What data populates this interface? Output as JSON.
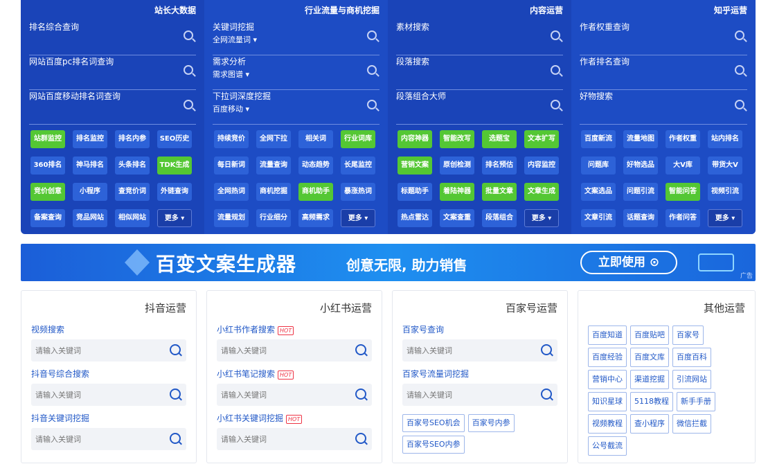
{
  "top": {
    "columns": [
      {
        "title": "站长大数据",
        "rows": [
          {
            "label": "排名综合查询",
            "sub": ""
          },
          {
            "label": "网站百度pc排名词查询",
            "sub": ""
          },
          {
            "label": "网站百度移动排名词查询",
            "sub": ""
          }
        ],
        "buttons": [
          {
            "label": "站群监控",
            "tone": "g"
          },
          {
            "label": "排名监控",
            "tone": "b"
          },
          {
            "label": "排名内参",
            "tone": "b"
          },
          {
            "label": "SEO历史",
            "tone": "b"
          },
          {
            "label": "360排名",
            "tone": "b"
          },
          {
            "label": "神马排名",
            "tone": "b"
          },
          {
            "label": "头条排名",
            "tone": "b"
          },
          {
            "label": "TDK生成",
            "tone": "g"
          },
          {
            "label": "竞价创意",
            "tone": "g"
          },
          {
            "label": "小程序",
            "tone": "b"
          },
          {
            "label": "查竞价词",
            "tone": "b"
          },
          {
            "label": "外链查询",
            "tone": "b"
          },
          {
            "label": "备案查询",
            "tone": "b"
          },
          {
            "label": "竞品网站",
            "tone": "b"
          },
          {
            "label": "相似网站",
            "tone": "b"
          },
          {
            "label": "更多 ▾",
            "tone": "m"
          }
        ]
      },
      {
        "title": "行业流量与商机挖掘",
        "rows": [
          {
            "label": "关键词挖掘",
            "sub": "全网流量词 ▾"
          },
          {
            "label": "需求分析",
            "sub": "需求图谱 ▾"
          },
          {
            "label": "下拉词深度挖掘",
            "sub": "百度移动 ▾"
          }
        ],
        "buttons": [
          {
            "label": "持续竞价",
            "tone": "b"
          },
          {
            "label": "全网下拉",
            "tone": "b"
          },
          {
            "label": "相关词",
            "tone": "b"
          },
          {
            "label": "行业词库",
            "tone": "g"
          },
          {
            "label": "每日新词",
            "tone": "b"
          },
          {
            "label": "流量查询",
            "tone": "b"
          },
          {
            "label": "动态趋势",
            "tone": "b"
          },
          {
            "label": "长尾监控",
            "tone": "b"
          },
          {
            "label": "全网热词",
            "tone": "b"
          },
          {
            "label": "商机挖掘",
            "tone": "b"
          },
          {
            "label": "商机助手",
            "tone": "g"
          },
          {
            "label": "暴涨热词",
            "tone": "b"
          },
          {
            "label": "流量规划",
            "tone": "b"
          },
          {
            "label": "行业细分",
            "tone": "b"
          },
          {
            "label": "高频需求",
            "tone": "b"
          },
          {
            "label": "更多 ▾",
            "tone": "m"
          }
        ]
      },
      {
        "title": "内容运营",
        "rows": [
          {
            "label": "素材搜索",
            "sub": ""
          },
          {
            "label": "段落搜索",
            "sub": ""
          },
          {
            "label": "段落组合大师",
            "sub": ""
          }
        ],
        "buttons": [
          {
            "label": "内容神器",
            "tone": "g"
          },
          {
            "label": "智能改写",
            "tone": "g"
          },
          {
            "label": "选题宝",
            "tone": "g"
          },
          {
            "label": "文本扩写",
            "tone": "g"
          },
          {
            "label": "营销文案",
            "tone": "g"
          },
          {
            "label": "原创检测",
            "tone": "b"
          },
          {
            "label": "排名预估",
            "tone": "b"
          },
          {
            "label": "内容监控",
            "tone": "b"
          },
          {
            "label": "标题助手",
            "tone": "b"
          },
          {
            "label": "着陆神器",
            "tone": "g"
          },
          {
            "label": "批量文章",
            "tone": "g"
          },
          {
            "label": "文章生成",
            "tone": "g"
          },
          {
            "label": "热点雷达",
            "tone": "b"
          },
          {
            "label": "文案查重",
            "tone": "b"
          },
          {
            "label": "段落组合",
            "tone": "b"
          },
          {
            "label": "更多 ▾",
            "tone": "m"
          }
        ]
      },
      {
        "title": "知乎运营",
        "rows": [
          {
            "label": "作者权重查询",
            "sub": ""
          },
          {
            "label": "作者排名查询",
            "sub": ""
          },
          {
            "label": "好物搜索",
            "sub": ""
          }
        ],
        "buttons": [
          {
            "label": "百度新流",
            "tone": "b"
          },
          {
            "label": "流量地图",
            "tone": "b"
          },
          {
            "label": "作者权重",
            "tone": "b"
          },
          {
            "label": "站内排名",
            "tone": "b"
          },
          {
            "label": "问题库",
            "tone": "b"
          },
          {
            "label": "好物选品",
            "tone": "b"
          },
          {
            "label": "大V库",
            "tone": "b"
          },
          {
            "label": "带货大V",
            "tone": "b"
          },
          {
            "label": "文案选品",
            "tone": "b"
          },
          {
            "label": "问题引流",
            "tone": "b"
          },
          {
            "label": "智能问答",
            "tone": "g"
          },
          {
            "label": "视频引流",
            "tone": "b"
          },
          {
            "label": "文章引流",
            "tone": "b"
          },
          {
            "label": "话题查询",
            "tone": "b"
          },
          {
            "label": "作者问答",
            "tone": "b"
          },
          {
            "label": "更多 ▾",
            "tone": "m"
          }
        ]
      }
    ]
  },
  "banner": {
    "title": "百变文案生成器",
    "slogan": "创意无限, 助力销售",
    "cta": "立即使用 ⊙",
    "ad": "广告"
  },
  "cards": {
    "douyin": {
      "title": "抖音运营",
      "fields": [
        {
          "label": "视频搜索",
          "placeholder": "请输入关键词"
        },
        {
          "label": "抖音号综合搜索",
          "placeholder": "请输入关键词"
        },
        {
          "label": "抖音关键词挖掘",
          "placeholder": "请输入关键词"
        }
      ]
    },
    "xhs": {
      "title": "小红书运营",
      "hot": "HOT",
      "fields": [
        {
          "label": "小红书作者搜索",
          "placeholder": "请输入关键词"
        },
        {
          "label": "小红书笔记搜索",
          "placeholder": "请输入关键词"
        },
        {
          "label": "小红书关键词挖掘",
          "placeholder": "请输入关键词"
        }
      ]
    },
    "baijia": {
      "title": "百家号运营",
      "fields": [
        {
          "label": "百家号查询",
          "placeholder": "请输入关键词"
        },
        {
          "label": "百家号流量词挖掘",
          "placeholder": "请输入关键词"
        }
      ],
      "chips": [
        "百家号SEO机会",
        "百家号内参",
        "百家号SEO内参"
      ]
    },
    "other": {
      "title": "其他运营",
      "chips": [
        "百度知道",
        "百度贴吧",
        "百家号",
        "百度经验",
        "百度文库",
        "百度百科",
        "营销中心",
        "渠道挖掘",
        "引流网站",
        "知识星球",
        "5118教程",
        "新手手册",
        "视频教程",
        "查小程序",
        "微信拦截",
        "公号截流"
      ]
    }
  }
}
